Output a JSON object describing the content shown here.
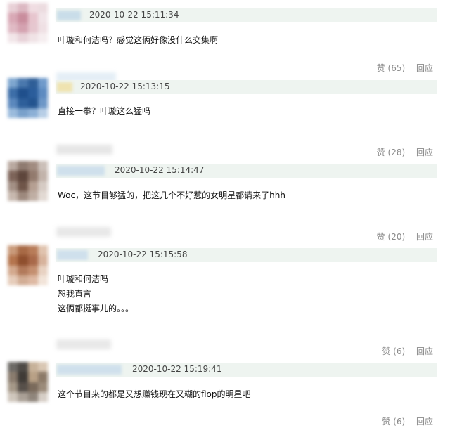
{
  "comments": [
    {
      "time": "2020-10-22 15:11:34",
      "lines": [
        "叶璇和何洁吗？感觉这俩好像没什么交集啊"
      ],
      "like_label": "赞",
      "like_count": "(65)",
      "reply_label": "回应",
      "avatar_colors": [
        "#e8d0d6",
        "#dcb8c2",
        "#f0dde2",
        "#ecdce0",
        "#d9a9b6",
        "#c98d9d",
        "#e7c5ce",
        "#f1e4e8",
        "#e0bac4",
        "#d4a2b0",
        "#e6c7cf",
        "#efe0e4",
        "#f2e6e9",
        "#e8d3d9",
        "#f0e3e6",
        "#f6eef0"
      ]
    },
    {
      "time": "2020-10-22 15:13:15",
      "lines": [
        "直接一拳？叶璇这么猛吗"
      ],
      "like_label": "赞",
      "like_count": "(28)",
      "reply_label": "回应",
      "avatar_colors": [
        "#7ea6cf",
        "#4a78ad",
        "#2f5e97",
        "#6f9acb",
        "#3d6ea8",
        "#1f4f8c",
        "#2b5d9b",
        "#5d8bc1",
        "#5b88bd",
        "#2e5f9a",
        "#23548f",
        "#6d97c7",
        "#9bbbdc",
        "#7aa1cb",
        "#8cb0d6",
        "#b7cee6"
      ]
    },
    {
      "time": "2020-10-22 15:14:47",
      "lines": [
        "Woc，这节目够猛的，把这几个不好惹的女明星都请来了hhh"
      ],
      "like_label": "赞",
      "like_count": "(20)",
      "reply_label": "回应",
      "avatar_colors": [
        "#b9a9a0",
        "#8f7b70",
        "#a18c80",
        "#cbbfb8",
        "#7d6459",
        "#5e463c",
        "#927a6d",
        "#c2b3aa",
        "#a39085",
        "#6f5549",
        "#b59f92",
        "#d6cbc4",
        "#c7b8ae",
        "#9d897d",
        "#bfaea3",
        "#e2d9d3"
      ]
    },
    {
      "time": "2020-10-22 15:15:58",
      "lines": [
        "叶璇和何洁吗",
        "恕我直言",
        "这俩都挺事儿的。。。"
      ],
      "like_label": "赞",
      "like_count": "(6)",
      "reply_label": "回应",
      "avatar_colors": [
        "#c99a7a",
        "#a86a46",
        "#b87c59",
        "#e0c3ae",
        "#b5754e",
        "#8f4f2e",
        "#a9694a",
        "#d7b39c",
        "#d3a98e",
        "#b27a5b",
        "#c48f70",
        "#e8d2c2",
        "#e6cdbb",
        "#d2ad95",
        "#deb9a3",
        "#f2e4d9"
      ]
    },
    {
      "time": "2020-10-22 15:19:41",
      "lines": [
        "这个节目来的都是又想赚钱现在又糊的flop的明星吧"
      ],
      "like_label": "赞",
      "like_count": "(6)",
      "reply_label": "回应",
      "avatar_colors": [
        "#6d6a66",
        "#4e4a46",
        "#c7b29a",
        "#d9c7b3",
        "#8a7c6e",
        "#3f3a36",
        "#b9a186",
        "#8c7a68",
        "#a59888",
        "#57504a",
        "#7a6a5b",
        "#9b8b7a",
        "#cfc6bc",
        "#aaa096",
        "#8f857b",
        "#d6cec6"
      ]
    }
  ]
}
